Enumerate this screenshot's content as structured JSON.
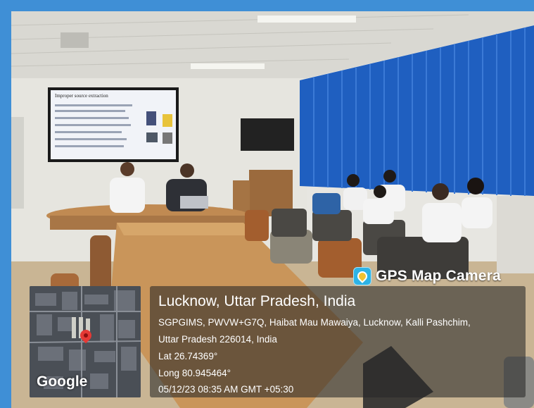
{
  "overlay": {
    "app_name": "GPS Map Camera",
    "app_icon": "gps-map-camera-icon",
    "map_attribution": "Google",
    "location_title": "Lucknow, Uttar Pradesh, India",
    "address_line_1": "SGPGIMS, PWVW+G7Q, Haibat Mau Mawaiya, Lucknow, Kalli Pashchim,",
    "address_line_2": "Uttar Pradesh 226014, India",
    "latitude": "Lat 26.74369°",
    "longitude": "Long 80.945464°",
    "timestamp": "05/12/23 08:35 AM GMT +05:30",
    "pin_icon": "map-pin-icon"
  },
  "slide": {
    "title": "Improper source extraction"
  },
  "colors": {
    "frame": "#3f8fd6",
    "blinds": "#1f5fc0",
    "table": "#c9955a",
    "wall": "#e7e6e1"
  }
}
